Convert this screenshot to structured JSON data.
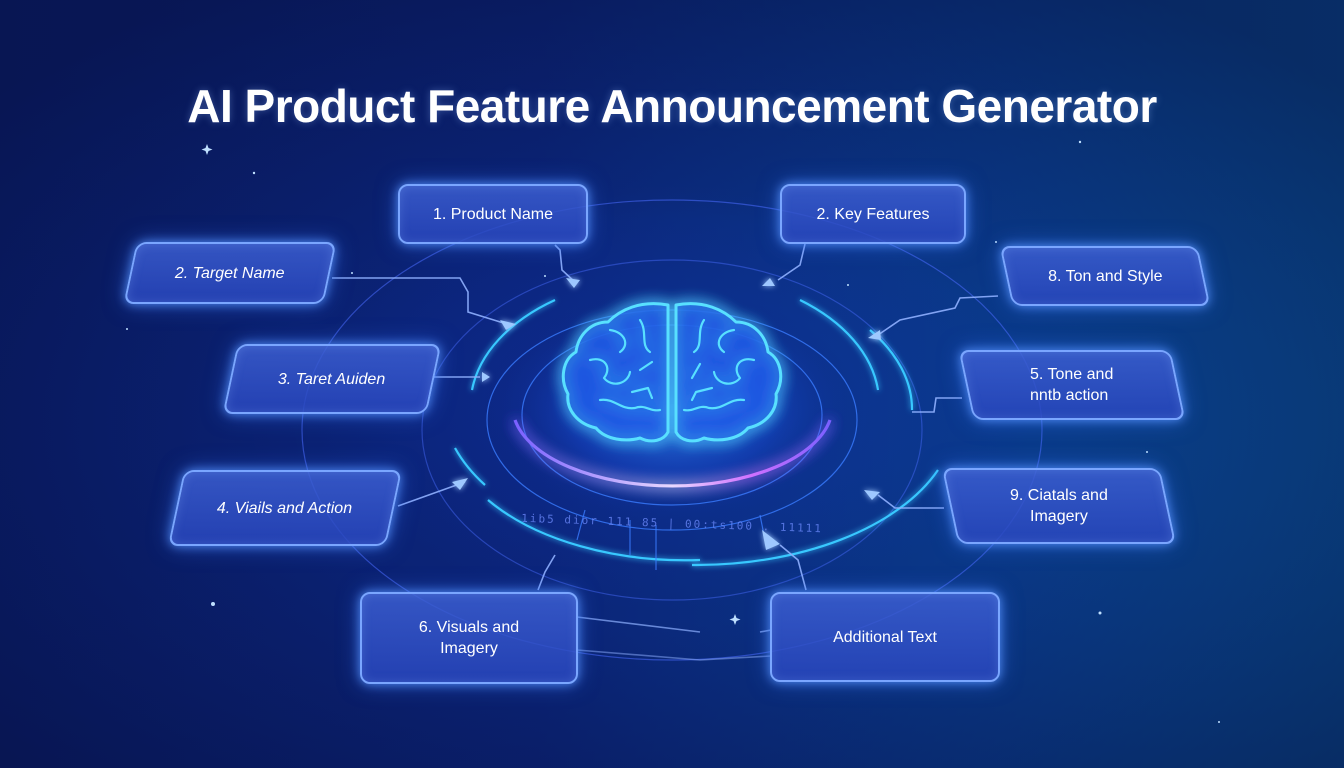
{
  "header": {
    "title": "AI Product Feature Announcement Generator"
  },
  "center": {
    "icon": "brain-icon",
    "ring_glyph_text": "1ib5 dior 111 85 | 00:ts100 . 11111"
  },
  "nodes": [
    {
      "id": "product-name",
      "label": "1. Product Name"
    },
    {
      "id": "key-features",
      "label": "2. Key Features"
    },
    {
      "id": "target-name",
      "label": "2. Target Name"
    },
    {
      "id": "ton-and-style",
      "label": "8. Ton and Style"
    },
    {
      "id": "target-audience",
      "label": "3. Taret Auiden"
    },
    {
      "id": "tone-and-interaction",
      "label": "5. Tone and\n   nntb action"
    },
    {
      "id": "visuals-and-action",
      "label": "4. Viails and Action"
    },
    {
      "id": "ciatals-and-imagery",
      "label": "9. Ciatals and\nImagery"
    },
    {
      "id": "visuals-and-imagery",
      "label": "6. Visuals and\nImagery"
    },
    {
      "id": "additional-text",
      "label": "Additional Text"
    }
  ],
  "colors": {
    "background": "#0b2478",
    "box_fill": "#3c5fd2",
    "box_border": "#7aa6ff",
    "ring_cyan": "#38c8ff",
    "ring_violet": "#a070ff",
    "brain_glow": "#40d8ff"
  }
}
